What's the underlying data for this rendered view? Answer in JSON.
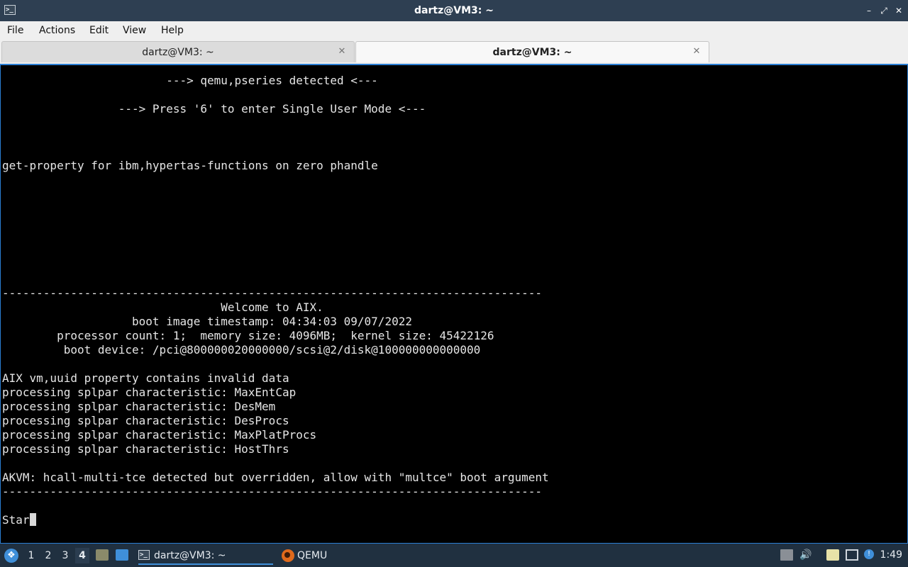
{
  "window": {
    "title": "dartz@VM3: ~",
    "app_icon": ">_",
    "buttons": [
      "minimize-icon",
      "restore-icon",
      "close-icon"
    ]
  },
  "menubar": {
    "file": "File",
    "actions": "Actions",
    "edit": "Edit",
    "view": "View",
    "help": "Help"
  },
  "tabs": [
    {
      "label": "dartz@VM3: ~",
      "active": false
    },
    {
      "label": "dartz@VM3: ~",
      "active": true
    }
  ],
  "terminal": {
    "lines": [
      "                        ---> qemu,pseries detected <---",
      "",
      "                 ---> Press '6' to enter Single User Mode <---",
      "",
      "",
      "",
      "get-property for ibm,hypertas-functions on zero phandle",
      "",
      "",
      "",
      "",
      "",
      "",
      "",
      "",
      "-------------------------------------------------------------------------------",
      "                                Welcome to AIX.",
      "                   boot image timestamp: 04:34:03 09/07/2022",
      "        processor count: 1;  memory size: 4096MB;  kernel size: 45422126",
      "         boot device: /pci@800000020000000/scsi@2/disk@100000000000000",
      "",
      "AIX vm,uuid property contains invalid data",
      "processing splpar characteristic: MaxEntCap",
      "processing splpar characteristic: DesMem",
      "processing splpar characteristic: DesProcs",
      "processing splpar characteristic: MaxPlatProcs",
      "processing splpar characteristic: HostThrs",
      "",
      "AKVM: hcall-multi-tce detected but overridden, allow with \"multce\" boot argument",
      "-------------------------------------------------------------------------------",
      ""
    ],
    "prompt_text": "Star"
  },
  "taskbar": {
    "workspaces": [
      "1",
      "2",
      "3",
      "4"
    ],
    "active_workspace": "4",
    "tasks": [
      {
        "label": "dartz@VM3: ~",
        "icon": "terminal-icon"
      },
      {
        "label": "QEMU",
        "icon": "qemu-icon"
      }
    ],
    "clock": "1:49"
  },
  "colors": {
    "titlebar": "#2e3f52",
    "terminal_bg": "#000000",
    "terminal_fg": "#e6e6e6",
    "accent": "#2b7fd4",
    "taskbar": "#203040"
  }
}
